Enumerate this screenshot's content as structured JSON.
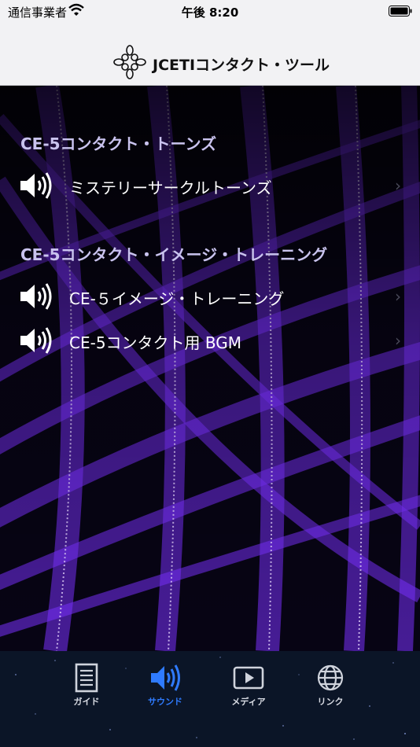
{
  "status_bar": {
    "carrier": "通信事業者",
    "time": "午後 8:20"
  },
  "nav": {
    "title": "JCETIコンタクト・ツール"
  },
  "sections": [
    {
      "header": "CE-5コンタクト・トーンズ",
      "items": [
        {
          "label": "ミステリーサークルトーンズ"
        }
      ]
    },
    {
      "header": "CE-5コンタクト・イメージ・トレーニング",
      "items": [
        {
          "label": "CE-５イメージ・トレーニング"
        },
        {
          "label": "CE-5コンタクト用 BGM"
        }
      ]
    }
  ],
  "chevron": "›",
  "tabs": [
    {
      "label": "ガイド",
      "icon": "document-icon"
    },
    {
      "label": "サウンド",
      "icon": "speaker-icon",
      "active": true
    },
    {
      "label": "メディア",
      "icon": "play-icon"
    },
    {
      "label": "リンク",
      "icon": "globe-icon"
    }
  ],
  "colors": {
    "accent": "#2f7bff",
    "section_header": "#c9c3ee",
    "laser": "#8a3cff"
  }
}
